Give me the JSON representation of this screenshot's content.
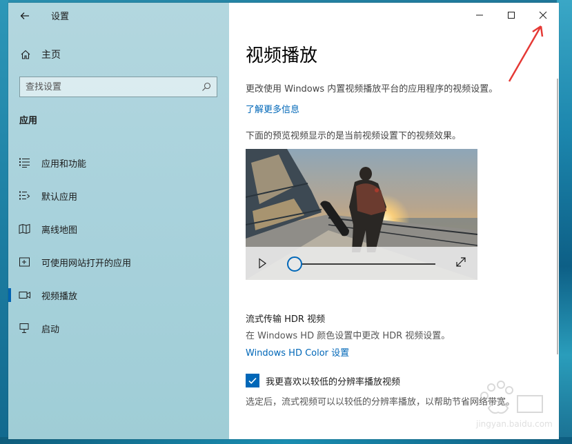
{
  "window": {
    "app_title": "设置"
  },
  "sidebar": {
    "home_label": "主页",
    "search_placeholder": "查找设置",
    "section_label": "应用",
    "items": [
      {
        "label": "应用和功能",
        "icon": "list-icon"
      },
      {
        "label": "默认应用",
        "icon": "default-apps-icon"
      },
      {
        "label": "离线地图",
        "icon": "map-icon"
      },
      {
        "label": "可使用网站打开的应用",
        "icon": "website-apps-icon"
      },
      {
        "label": "视频播放",
        "icon": "video-icon",
        "active": true
      },
      {
        "label": "启动",
        "icon": "startup-icon"
      }
    ]
  },
  "main": {
    "title": "视频播放",
    "description": "更改使用 Windows 内置视频播放平台的应用程序的视频设置。",
    "learn_more": "了解更多信息",
    "preview_description": "下面的预览视频显示的是当前视频设置下的视频效果。",
    "video": {
      "progress": 0.0
    },
    "hdr": {
      "title": "流式传输 HDR 视频",
      "description": "在 Windows HD 颜色设置中更改 HDR 视频设置。",
      "link": "Windows HD Color 设置"
    },
    "low_res": {
      "checked": true,
      "label": "我更喜欢以较低的分辨率播放视频",
      "description": "选定后，流式视频可以以较低的分辨率播放，以帮助节省网络带宽。"
    }
  },
  "watermark": {
    "text": "jingyan.baidu.com"
  },
  "colors": {
    "accent": "#0067b8",
    "annotation": "#e53935",
    "sidebar_bg": "#a9d2dc"
  }
}
